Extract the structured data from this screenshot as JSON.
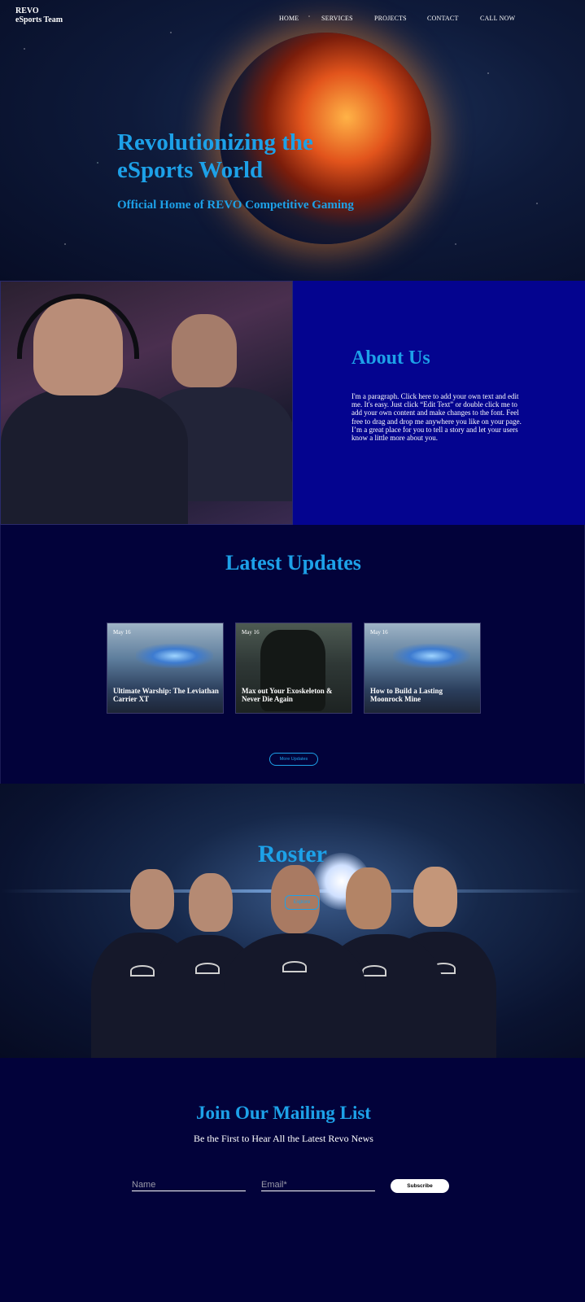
{
  "brand": {
    "line1": "REVO",
    "line2": "eSports Team"
  },
  "nav": {
    "items": [
      "HOME",
      "SERVICES",
      "PROJECTS",
      "CONTACT",
      "CALL NOW"
    ]
  },
  "hero": {
    "title": "Revolutionizing the eSports World",
    "subtitle": "Official Home of REVO Competitive Gaming"
  },
  "about": {
    "title": "About Us",
    "text": "I'm a paragraph. Click here to add your own text and edit me. It's easy. Just click “Edit Text” or double click me to add your own content and make changes to the font. Feel free to drag and drop me anywhere you like on your page. I’m a great place for you to tell a story and let your users know a little more about you."
  },
  "updates": {
    "title": "Latest Updates",
    "cards": [
      {
        "date": "May 16",
        "title": "Ultimate Warship: The Leviathan Carrier XT"
      },
      {
        "date": "May 16",
        "title": "Max out Your Exoskeleton & Never Die Again"
      },
      {
        "date": "May 16",
        "title": "How to Build a Lasting Moonrock Mine"
      }
    ],
    "more_label": "More Updates"
  },
  "roster": {
    "title": "Roster",
    "button_label": "Explore"
  },
  "mailing": {
    "title": "Join Our Mailing List",
    "subtitle": "Be the First to Hear All the Latest Revo News",
    "name_placeholder": "Name",
    "email_placeholder": "Email*",
    "subscribe_label": "Subscribe"
  },
  "colors": {
    "accent": "#1da1e8",
    "background": "#02023a",
    "about_panel": "#04048f"
  }
}
